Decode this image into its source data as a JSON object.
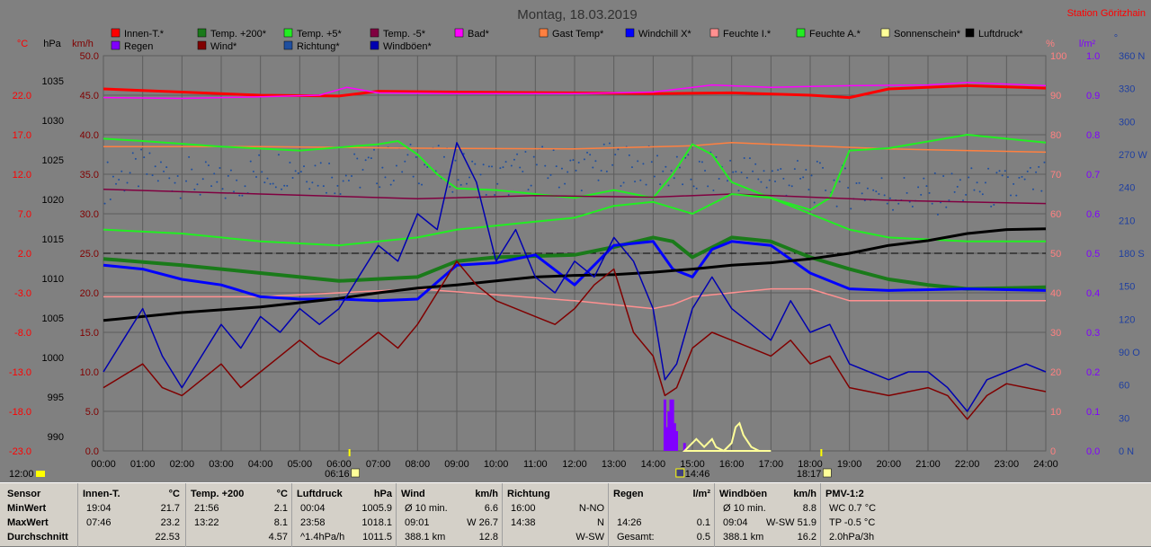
{
  "title": "Montag, 18.03.2019",
  "station": "Station Göritzhain",
  "colors": {
    "temp_in": "#ff0000",
    "temp200": "#1a7a1a",
    "temp5": "#22ee22",
    "temp_m5": "#800040",
    "bad": "#ff00ff",
    "gast": "#ff8040",
    "windchill": "#0000ff",
    "feuchte_i": "#ff9090",
    "feuchte_a": "#22ee22",
    "sonne": "#ffff99",
    "luftdruck": "#000000",
    "regen": "#8000ff",
    "wind": "#800000",
    "richtung": "#1f4f9f",
    "windboeen": "#0000b0"
  },
  "axis_units": {
    "celsius": "°C",
    "hpa": "hPa",
    "kmh": "km/h",
    "percent": "%",
    "rain": "l/m²",
    "dir": "°"
  },
  "legend_row1": [
    {
      "label": "Innen-T.*",
      "color": "#ff0000"
    },
    {
      "label": "Temp. +200*",
      "color": "#1a7a1a"
    },
    {
      "label": "Temp. +5*",
      "color": "#22ee22"
    },
    {
      "label": "Temp. -5*",
      "color": "#800040"
    },
    {
      "label": "Bad*",
      "color": "#ff00ff"
    },
    {
      "label": "Gast Temp*",
      "color": "#ff8040"
    },
    {
      "label": "Windchill X*",
      "color": "#0000ff"
    },
    {
      "label": "Feuchte I.*",
      "color": "#ff9090"
    },
    {
      "label": "Feuchte A.*",
      "color": "#22ee22"
    },
    {
      "label": "Sonnenschein*",
      "color": "#ffff99"
    },
    {
      "label": "Luftdruck*",
      "color": "#000000"
    }
  ],
  "legend_row2": [
    {
      "label": "Regen",
      "color": "#8000ff"
    },
    {
      "label": "Wind*",
      "color": "#800000"
    },
    {
      "label": "Richtung*",
      "color": "#1f4f9f"
    },
    {
      "label": "Windböen*",
      "color": "#0000b0"
    }
  ],
  "ticks": {
    "celsius": [
      "22.0",
      "17.0",
      "12.0",
      "7.0",
      "2.0",
      "-3.0",
      "-8.0",
      "-13.0",
      "-18.0",
      "-23.0"
    ],
    "hpa": [
      "1035",
      "1030",
      "1025",
      "1020",
      "1015",
      "1010",
      "1005",
      "1000",
      "995",
      "990"
    ],
    "kmh": [
      "50.0",
      "45.0",
      "40.0",
      "35.0",
      "30.0",
      "25.0",
      "20.0",
      "15.0",
      "10.0",
      "5.0",
      "0.0"
    ],
    "percent": [
      "100",
      "90",
      "80",
      "70",
      "60",
      "50",
      "40",
      "30",
      "20",
      "10",
      "0"
    ],
    "rain": [
      "1.0",
      "0.9",
      "0.8",
      "0.7",
      "0.6",
      "0.5",
      "0.4",
      "0.3",
      "0.2",
      "0.1",
      "0.0"
    ],
    "dir": [
      "360 N",
      "330",
      "300",
      "270 W",
      "240",
      "210",
      "180 S",
      "150",
      "120",
      "90 O",
      "60",
      "30",
      "0 N"
    ],
    "time": [
      "00:00",
      "01:00",
      "02:00",
      "03:00",
      "04:00",
      "05:00",
      "06:00",
      "07:00",
      "08:00",
      "09:00",
      "10:00",
      "11:00",
      "12:00",
      "13:00",
      "14:00",
      "15:00",
      "16:00",
      "17:00",
      "18:00",
      "19:00",
      "20:00",
      "21:00",
      "22:00",
      "23:00",
      "24:00"
    ]
  },
  "sun_markers": {
    "sunrise": "06:16",
    "sunset": "18:17",
    "noon": "14:46",
    "left_label": "12:00"
  },
  "chart_data": {
    "type": "line",
    "title": "Montag, 18.03.2019",
    "x_unit": "hour",
    "xlim": [
      0,
      24
    ],
    "y_axes": {
      "celsius": [
        -23,
        27
      ],
      "hpa": [
        990,
        1040
      ],
      "kmh": [
        0,
        50
      ],
      "percent": [
        0,
        100
      ],
      "rain": [
        0,
        1
      ],
      "dir": [
        0,
        360
      ]
    },
    "series": [
      {
        "name": "Innen-T.*",
        "axis": "celsius",
        "x": [
          0,
          2,
          4,
          6,
          7,
          9,
          12,
          14,
          16,
          18,
          19,
          20,
          22,
          24
        ],
        "y": [
          22.8,
          22.4,
          22.0,
          21.9,
          22.5,
          22.4,
          22.3,
          22.2,
          22.3,
          22.0,
          21.7,
          22.8,
          23.2,
          22.9
        ]
      },
      {
        "name": "Bad*",
        "axis": "celsius",
        "x": [
          0,
          2,
          4,
          5.5,
          6.2,
          7,
          9,
          12,
          14,
          15.5,
          17,
          19,
          21,
          22,
          24
        ],
        "y": [
          21.7,
          21.6,
          21.8,
          22.0,
          23.0,
          22.3,
          22.2,
          22.2,
          22.4,
          23.3,
          23.0,
          23.2,
          23.3,
          23.6,
          23.2
        ]
      },
      {
        "name": "Gast Temp*",
        "axis": "celsius",
        "x": [
          0,
          4,
          8,
          12,
          15,
          16,
          17,
          20,
          22,
          24
        ],
        "y": [
          15.5,
          15.5,
          15.3,
          15.2,
          15.6,
          16.0,
          15.8,
          15.2,
          15.0,
          14.8
        ]
      },
      {
        "name": "Temp. +5*",
        "axis": "celsius",
        "x": [
          0,
          1,
          3,
          5,
          7,
          7.5,
          8,
          8.5,
          9,
          10,
          12,
          13,
          14,
          14.5,
          15,
          15.5,
          16,
          17,
          18,
          18.5,
          19,
          20,
          22,
          24
        ],
        "y": [
          16.5,
          16.2,
          15.5,
          15.0,
          15.8,
          16.2,
          14.5,
          12.0,
          10.2,
          10.0,
          9.0,
          10.0,
          9.0,
          12.0,
          15.8,
          14.5,
          11.0,
          9.0,
          7.5,
          9.0,
          15.0,
          15.3,
          17.0,
          16.0
        ]
      },
      {
        "name": "Temp. -5*",
        "axis": "celsius",
        "x": [
          0,
          4,
          8,
          11,
          14,
          16,
          20,
          24
        ],
        "y": [
          10.1,
          9.5,
          8.9,
          9.3,
          9.1,
          9.5,
          8.7,
          8.3
        ]
      },
      {
        "name": "Temp. +200*",
        "axis": "celsius",
        "x": [
          0,
          2,
          4,
          6,
          8,
          9,
          10,
          12,
          13,
          14,
          14.5,
          15,
          16,
          17,
          18,
          19,
          20,
          21,
          22,
          24
        ],
        "y": [
          1.3,
          0.5,
          -0.5,
          -1.5,
          -1.0,
          1.0,
          1.5,
          1.8,
          2.8,
          4.0,
          3.5,
          1.5,
          4.0,
          3.5,
          1.5,
          0.0,
          -1.3,
          -2.0,
          -2.5,
          -2.3
        ]
      },
      {
        "name": "Feuchte A.*",
        "axis": "percent",
        "x": [
          0,
          2,
          4,
          6,
          8,
          8.5,
          9,
          10,
          11,
          12,
          13,
          14,
          15,
          16,
          17,
          18,
          19,
          20,
          22,
          24
        ],
        "y": [
          56,
          55,
          53,
          52,
          54,
          55,
          56,
          57,
          58,
          59,
          62,
          63,
          60,
          65,
          64,
          60,
          56,
          54,
          53,
          53
        ]
      },
      {
        "name": "Feuchte I.*",
        "axis": "percent",
        "x": [
          0,
          4,
          6,
          8,
          12,
          13,
          14,
          14.5,
          15,
          16,
          17,
          18,
          19,
          24
        ],
        "y": [
          39,
          39,
          40,
          41,
          38,
          37,
          36,
          37,
          39,
          40,
          41,
          41,
          38,
          38
        ]
      },
      {
        "name": "Windchill X*",
        "axis": "celsius",
        "x": [
          0,
          1,
          2,
          3,
          4,
          5,
          6,
          7,
          8,
          9,
          10,
          11,
          12,
          13,
          14,
          14.5,
          15,
          15.5,
          16,
          17,
          18,
          19,
          20,
          22,
          24
        ],
        "y": [
          0.5,
          0.0,
          -1.3,
          -2.0,
          -3.5,
          -3.8,
          -3.8,
          -4.0,
          -3.8,
          0.5,
          0.8,
          1.8,
          -2.0,
          3.0,
          3.5,
          0.0,
          -1.0,
          2.5,
          3.5,
          3.0,
          -0.5,
          -2.5,
          -2.7,
          -2.5,
          -2.7
        ]
      },
      {
        "name": "Luftdruck*",
        "axis": "hpa",
        "x": [
          0,
          2,
          4,
          6,
          7,
          8,
          9,
          10,
          11,
          12,
          13,
          14,
          15,
          16,
          17,
          18,
          19,
          20,
          21,
          22,
          23,
          24
        ],
        "y": [
          1006.5,
          1007.5,
          1008.2,
          1009.3,
          1010.0,
          1010.6,
          1011.0,
          1011.5,
          1012.0,
          1012.2,
          1012.3,
          1012.6,
          1013.0,
          1013.5,
          1013.8,
          1014.3,
          1015.0,
          1016.0,
          1016.6,
          1017.5,
          1018.0,
          1018.1
        ]
      },
      {
        "name": "Wind*",
        "axis": "kmh",
        "x": [
          0,
          0.5,
          1,
          1.5,
          2,
          2.5,
          3,
          3.5,
          4,
          4.5,
          5,
          5.5,
          6,
          6.5,
          7,
          7.5,
          8,
          8.5,
          9,
          9.5,
          10,
          10.5,
          11,
          11.5,
          12,
          12.5,
          13,
          13.5,
          14,
          14.3,
          14.6,
          15,
          15.5,
          16,
          16.5,
          17,
          17.5,
          18,
          18.5,
          19,
          19.5,
          20,
          20.5,
          21,
          21.5,
          22,
          22.5,
          23,
          23.5,
          24
        ],
        "y": [
          8,
          9.5,
          11,
          8,
          7,
          9,
          11,
          8,
          10,
          12,
          14,
          12,
          11,
          13,
          15,
          13,
          16,
          20,
          24,
          21,
          19,
          18,
          17,
          16,
          18,
          21,
          23,
          15,
          12,
          7,
          8,
          13,
          15,
          14,
          13,
          12,
          14,
          11,
          12,
          8,
          7.5,
          7,
          7.5,
          8,
          7,
          4,
          7,
          8.5,
          8,
          7.5
        ]
      },
      {
        "name": "Windböen*",
        "axis": "kmh",
        "x": [
          0,
          0.5,
          1,
          1.5,
          2,
          2.5,
          3,
          3.5,
          4,
          4.5,
          5,
          5.5,
          6,
          6.5,
          7,
          7.5,
          8,
          8.5,
          9,
          9.5,
          10,
          10.5,
          11,
          11.5,
          12,
          12.5,
          13,
          13.5,
          14,
          14.3,
          14.6,
          15,
          15.5,
          16,
          16.5,
          17,
          17.5,
          18,
          18.5,
          19,
          19.5,
          20,
          20.5,
          21,
          21.5,
          22,
          22.5,
          23,
          23.5,
          24
        ],
        "y": [
          10,
          14,
          18,
          12,
          8,
          12,
          16,
          13,
          17,
          15,
          18,
          16,
          18,
          22,
          26,
          24,
          30,
          28,
          39,
          34,
          24,
          28,
          22,
          20,
          24,
          22,
          27,
          24,
          18,
          9,
          11,
          18,
          22,
          18,
          16,
          14,
          19,
          15,
          16,
          11,
          10,
          9,
          10,
          10,
          8,
          5,
          9,
          10,
          11,
          10
        ]
      },
      {
        "name": "Richtung*",
        "axis": "dir",
        "type": "scatter",
        "note_density": "dense",
        "x": [
          0,
          1,
          2,
          3,
          4,
          5,
          6,
          7,
          8,
          9,
          10,
          11,
          12,
          13,
          14,
          15,
          16,
          17,
          18,
          19,
          20,
          21,
          22,
          23,
          24
        ],
        "y": [
          245,
          255,
          250,
          240,
          255,
          260,
          250,
          258,
          262,
          255,
          245,
          260,
          255,
          262,
          258,
          250,
          255,
          250,
          245,
          240,
          235,
          232,
          240,
          238,
          245
        ]
      },
      {
        "name": "Regen",
        "axis": "rain",
        "type": "bar",
        "x": [
          14.3,
          14.35,
          14.4,
          14.45,
          14.5,
          14.55,
          14.6,
          14.8
        ],
        "y": [
          0.13,
          0.06,
          0.1,
          0.13,
          0.13,
          0.07,
          0.05,
          0.02
        ]
      },
      {
        "name": "Sonnenschein*",
        "axis": "percent",
        "type": "area",
        "x": [
          14.8,
          15.0,
          15.1,
          15.3,
          15.5,
          15.6,
          15.8,
          16.0,
          16.1,
          16.2,
          16.3,
          16.5,
          16.7,
          17.0
        ],
        "y": [
          0,
          2,
          3,
          1,
          3,
          1,
          0,
          2,
          6,
          7,
          4,
          1,
          0,
          0
        ]
      }
    ],
    "reference_line": {
      "axis": "celsius",
      "value": 2.0,
      "style": "dashed"
    }
  },
  "stats": {
    "rows": [
      "Sensor",
      "MinWert",
      "MaxWert",
      "Durchschnitt"
    ],
    "columns": [
      {
        "title": "Innen-T.",
        "unit": "°C",
        "lines": [
          [
            "19:04",
            "21.7"
          ],
          [
            "07:46",
            "23.2"
          ],
          [
            "",
            "22.53"
          ]
        ]
      },
      {
        "title": "Temp. +200",
        "unit": "°C",
        "lines": [
          [
            "21:56",
            "2.1"
          ],
          [
            "13:22",
            "8.1"
          ],
          [
            "",
            "4.57"
          ]
        ]
      },
      {
        "title": "Luftdruck",
        "unit": "hPa",
        "lines": [
          [
            "00:04",
            "1005.9"
          ],
          [
            "23:58",
            "1018.1"
          ],
          [
            "^1.4hPa/h",
            "1011.5"
          ]
        ]
      },
      {
        "title": "Wind",
        "unit": "km/h",
        "lines": [
          [
            "Ø 10 min.",
            "6.6"
          ],
          [
            "09:01",
            "W 26.7"
          ],
          [
            "388.1 km",
            "12.8"
          ]
        ]
      },
      {
        "title": "Richtung",
        "unit": "",
        "lines": [
          [
            "16:00",
            "N-NO"
          ],
          [
            "14:38",
            "N"
          ],
          [
            "",
            "W-SW"
          ]
        ]
      },
      {
        "title": "Regen",
        "unit": "l/m²",
        "lines": [
          [
            "",
            ""
          ],
          [
            "14:26",
            "0.1"
          ],
          [
            "Gesamt:",
            "0.5"
          ]
        ]
      },
      {
        "title": "Windböen",
        "unit": "km/h",
        "lines": [
          [
            "Ø 10 min.",
            "8.8"
          ],
          [
            "09:04",
            "W-SW 51.9"
          ],
          [
            "388.1 km",
            "16.2"
          ]
        ]
      },
      {
        "title": "PMV-1:2",
        "unit": "",
        "lines": [
          [
            "WC 0.7 °C",
            ""
          ],
          [
            "TP -0.5 °C",
            ""
          ],
          [
            "2.0hPa/3h",
            ""
          ]
        ]
      }
    ]
  }
}
